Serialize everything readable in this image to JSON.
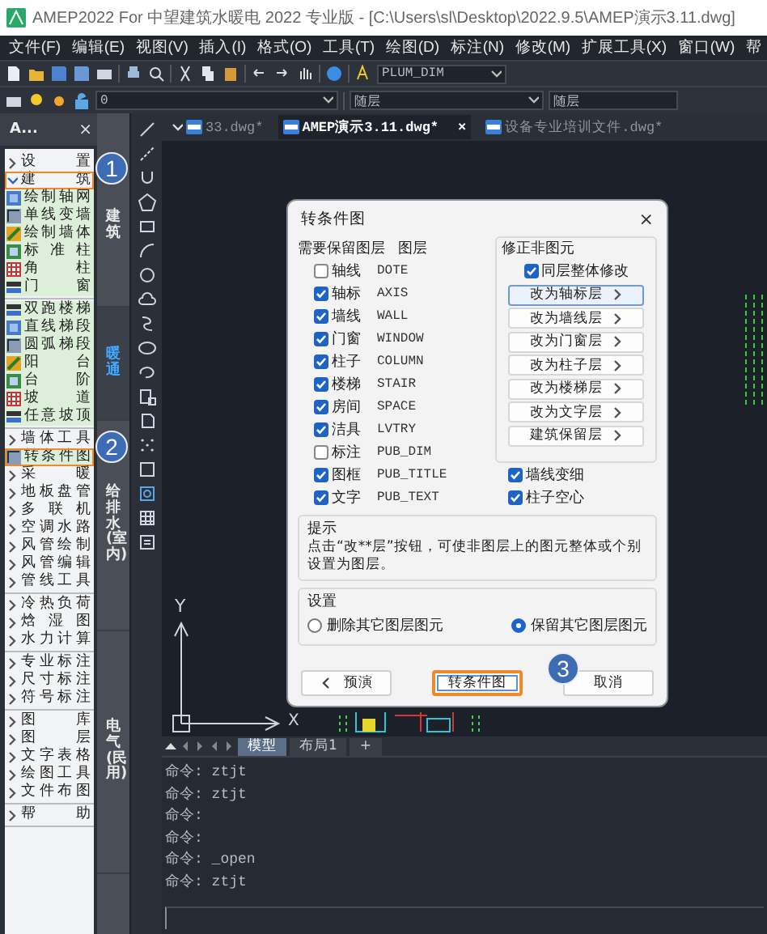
{
  "window": {
    "title": "AMEP2022 For 中望建筑水暖电 2022 专业版 - [C:\\Users\\sl\\Desktop\\2022.9.5\\AMEP演示3.11.dwg]"
  },
  "menu": [
    "文件(F)",
    "编辑(E)",
    "视图(V)",
    "插入(I)",
    "格式(O)",
    "工具(T)",
    "绘图(D)",
    "标注(N)",
    "修改(M)",
    "扩展工具(X)",
    "窗口(W)",
    "帮"
  ],
  "toolbar": {
    "text_style": "PLUM_DIM",
    "layer": "0",
    "color_setting": "随层",
    "linetype": "随层"
  },
  "panel": {
    "title": "A...",
    "close": "×",
    "sections": [
      {
        "items": [
          {
            "kind": "group",
            "label": "设 置",
            "expanded": false,
            "highlighted": false
          },
          {
            "kind": "group",
            "label": "建 筑",
            "expanded": true,
            "highlighted": true
          },
          {
            "kind": "tool",
            "label": "绘制轴网",
            "highlighted": false
          },
          {
            "kind": "tool",
            "label": "单线变墙",
            "highlighted": false
          },
          {
            "kind": "tool",
            "label": "绘制墙体",
            "highlighted": false
          },
          {
            "kind": "tool",
            "label": "标 准 柱",
            "highlighted": false
          },
          {
            "kind": "tool",
            "label": "角 柱",
            "highlighted": false
          },
          {
            "kind": "tool",
            "label": "门 窗",
            "highlighted": false
          }
        ]
      },
      {
        "items": [
          {
            "kind": "tool",
            "label": "双跑楼梯",
            "highlighted": false
          },
          {
            "kind": "tool",
            "label": "直线梯段",
            "highlighted": false
          },
          {
            "kind": "tool",
            "label": "圆弧梯段",
            "highlighted": false
          },
          {
            "kind": "tool",
            "label": "阳 台",
            "highlighted": false
          },
          {
            "kind": "tool",
            "label": "台 阶",
            "highlighted": false
          },
          {
            "kind": "tool",
            "label": "坡 道",
            "highlighted": false
          },
          {
            "kind": "tool",
            "label": "任意坡顶",
            "highlighted": false
          }
        ]
      },
      {
        "items": [
          {
            "kind": "group",
            "label": "墙体工具",
            "expanded": false,
            "highlighted": false
          },
          {
            "kind": "tool",
            "label": "转条件图",
            "highlighted": true
          },
          {
            "kind": "group",
            "label": "采 暖",
            "expanded": false,
            "highlighted": false
          },
          {
            "kind": "group",
            "label": "地板盘管",
            "expanded": false,
            "highlighted": false
          },
          {
            "kind": "group",
            "label": "多 联 机",
            "expanded": false,
            "highlighted": false
          },
          {
            "kind": "group",
            "label": "空调水路",
            "expanded": false,
            "highlighted": false
          },
          {
            "kind": "group",
            "label": "风管绘制",
            "expanded": false,
            "highlighted": false
          },
          {
            "kind": "group",
            "label": "风管编辑",
            "expanded": false,
            "highlighted": false
          },
          {
            "kind": "group",
            "label": "管线工具",
            "expanded": false,
            "highlighted": false
          }
        ]
      },
      {
        "items": [
          {
            "kind": "group",
            "label": "冷热负荷",
            "expanded": false,
            "highlighted": false
          },
          {
            "kind": "group",
            "label": "焓 湿 图",
            "expanded": false,
            "highlighted": false
          },
          {
            "kind": "group",
            "label": "水力计算",
            "expanded": false,
            "highlighted": false
          }
        ]
      },
      {
        "items": [
          {
            "kind": "group",
            "label": "专业标注",
            "expanded": false,
            "highlighted": false
          },
          {
            "kind": "group",
            "label": "尺寸标注",
            "expanded": false,
            "highlighted": false
          },
          {
            "kind": "group",
            "label": "符号标注",
            "expanded": false,
            "highlighted": false
          }
        ]
      },
      {
        "items": [
          {
            "kind": "group",
            "label": "图 库",
            "expanded": false,
            "highlighted": false
          },
          {
            "kind": "group",
            "label": "图 层",
            "expanded": false,
            "highlighted": false
          },
          {
            "kind": "group",
            "label": "文字表格",
            "expanded": false,
            "highlighted": false
          },
          {
            "kind": "group",
            "label": "绘图工具",
            "expanded": false,
            "highlighted": false
          },
          {
            "kind": "group",
            "label": "文件布图",
            "expanded": false,
            "highlighted": false
          }
        ]
      },
      {
        "items": [
          {
            "kind": "group",
            "label": "帮 助",
            "expanded": false,
            "highlighted": false
          }
        ]
      }
    ]
  },
  "side_tabs": [
    {
      "label": "建筑",
      "selected": false
    },
    {
      "label": "暖通",
      "selected": true
    },
    {
      "label": "给排水(室内)",
      "selected": false
    },
    {
      "label": "电气(民用)",
      "selected": false
    }
  ],
  "doc_tabs": [
    {
      "label": "33.dwg*",
      "selected": false
    },
    {
      "label": "AMEP演示3.11.dwg*",
      "selected": true,
      "close": "×"
    },
    {
      "label": "设备专业培训文件.dwg*",
      "selected": false
    }
  ],
  "ucs": {
    "y_label": "Y",
    "x_label": "X"
  },
  "dialog": {
    "title": "转条件图",
    "close": "×",
    "col_keep": "需要保留图层",
    "col_layer": "图层",
    "layers": [
      {
        "label": "轴线",
        "layer": "DOTE",
        "checked": false
      },
      {
        "label": "轴标",
        "layer": "AXIS",
        "checked": true
      },
      {
        "label": "墙线",
        "layer": "WALL",
        "checked": true
      },
      {
        "label": "门窗",
        "layer": "WINDOW",
        "checked": true
      },
      {
        "label": "柱子",
        "layer": "COLUMN",
        "checked": true
      },
      {
        "label": "楼梯",
        "layer": "STAIR",
        "checked": true
      },
      {
        "label": "房间",
        "layer": "SPACE",
        "checked": true
      },
      {
        "label": "洁具",
        "layer": "LVTRY",
        "checked": true
      },
      {
        "label": "标注",
        "layer": "PUB_DIM",
        "checked": false
      },
      {
        "label": "图框",
        "layer": "PUB_TITLE",
        "checked": true
      },
      {
        "label": "文字",
        "layer": "PUB_TEXT",
        "checked": true
      }
    ],
    "fix": {
      "title": "修正非图元",
      "same_layer": {
        "label": "同层整体修改",
        "checked": true
      },
      "buttons": [
        {
          "label": "改为轴标层",
          "focused": true
        },
        {
          "label": "改为墙线层",
          "focused": false
        },
        {
          "label": "改为门窗层",
          "focused": false
        },
        {
          "label": "改为柱子层",
          "focused": false
        },
        {
          "label": "改为楼梯层",
          "focused": false
        },
        {
          "label": "改为文字层",
          "focused": false
        },
        {
          "label": "建筑保留层",
          "focused": false
        }
      ]
    },
    "options": [
      {
        "label": "墙线变细",
        "checked": true
      },
      {
        "label": "柱子空心",
        "checked": true
      }
    ],
    "hint": {
      "title": "提示",
      "text": "点击“改**层”按钮，可使非图层上的图元整体或个别设置为图层。"
    },
    "settings": {
      "title": "设置",
      "radios": [
        {
          "label": "删除其它图层图元",
          "selected": false
        },
        {
          "label": "保留其它图层图元",
          "selected": true
        }
      ]
    },
    "buttons": [
      {
        "label": "预演",
        "kind": "back",
        "highlighted": false
      },
      {
        "label": "转条件图",
        "kind": "default",
        "highlighted": true
      },
      {
        "label": "取消",
        "kind": "plain",
        "highlighted": false
      }
    ]
  },
  "layout_tabs": [
    {
      "label": "模型",
      "selected": true
    },
    {
      "label": "布局1",
      "selected": false
    },
    {
      "label": "+",
      "selected": false
    }
  ],
  "command_lines": [
    "命令: ztjt",
    "命令: ztjt",
    "命令:",
    "命令:",
    "命令: _open",
    "命令: ztjt"
  ],
  "callouts": [
    {
      "label": "1"
    },
    {
      "label": "2"
    },
    {
      "label": "3"
    }
  ]
}
